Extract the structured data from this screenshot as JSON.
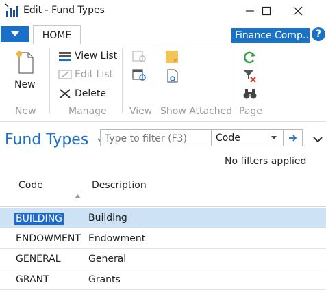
{
  "window": {
    "title": "Edit - Fund Types"
  },
  "ribbon": {
    "tab": "HOME",
    "company": "Finance Comp...",
    "help": "?",
    "groups": {
      "new": {
        "label": "New",
        "items": {
          "new": "New"
        }
      },
      "manage": {
        "label": "Manage",
        "items": {
          "view_list": "View List",
          "edit_list": "Edit List",
          "delete": "Delete"
        }
      },
      "view": {
        "label": "View"
      },
      "show_attached": {
        "label": "Show Attached"
      },
      "page": {
        "label": "Page"
      }
    }
  },
  "page": {
    "title": "Fund Types",
    "filter": {
      "placeholder": "Type to filter (F3)",
      "field": "Code"
    },
    "status": "No filters applied"
  },
  "table": {
    "columns": {
      "code": "Code",
      "description": "Description"
    },
    "rows": [
      {
        "code": "BUILDING",
        "description": "Building",
        "selected": true
      },
      {
        "code": "ENDOWMENT",
        "description": "Endowment",
        "selected": false
      },
      {
        "code": "GENERAL",
        "description": "General",
        "selected": false
      },
      {
        "code": "GRANT",
        "description": "Grants",
        "selected": false
      }
    ]
  },
  "colors": {
    "accent": "#1b6fc7",
    "selection": "#cde3f5",
    "selected_text_bg": "#1f69c9"
  }
}
